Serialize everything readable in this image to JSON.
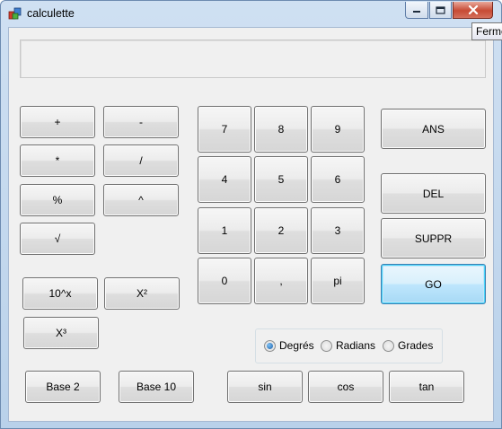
{
  "window": {
    "title": "calculette",
    "tooltip": "Fermer"
  },
  "display": {
    "value": ""
  },
  "operators": {
    "plus": "+",
    "minus": "-",
    "multiply": "*",
    "divide": "/",
    "percent": "%",
    "power": "^",
    "sqrt": "√"
  },
  "powers": {
    "ten_pow": "10^x",
    "square": "X²",
    "cube": "X³"
  },
  "digits": {
    "d7": "7",
    "d8": "8",
    "d9": "9",
    "d4": "4",
    "d5": "5",
    "d6": "6",
    "d1": "1",
    "d2": "2",
    "d3": "3",
    "d0": "0",
    "comma": ",",
    "pi": "pi"
  },
  "actions": {
    "ans": "ANS",
    "del": "DEL",
    "suppr": "SUPPR",
    "go": "GO"
  },
  "angle_mode": {
    "selected": "Degrés",
    "options": [
      "Degrés",
      "Radians",
      "Grades"
    ]
  },
  "bottom": {
    "base2": "Base 2",
    "base10": "Base 10",
    "sin": "sin",
    "cos": "cos",
    "tan": "tan"
  }
}
